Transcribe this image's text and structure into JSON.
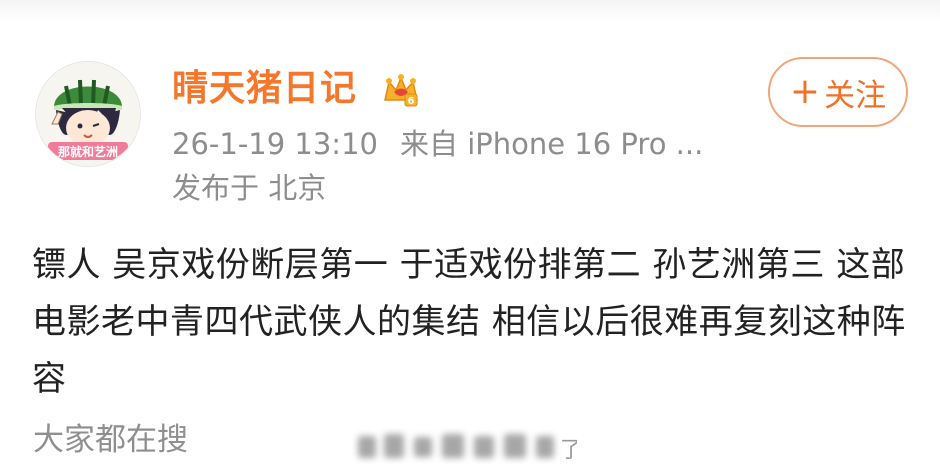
{
  "user": {
    "name": "晴天猪日记",
    "follow_label": "关注",
    "avatar_badge_text": "那就和艺洲"
  },
  "post": {
    "time": "26-1-19 13:10",
    "source": "来自 iPhone 16 Pro ...",
    "location": "发布于 北京",
    "body": "镖人 吴京戏份断层第一 于适戏份排第二 孙艺洲第三 这部电影老中青四代武侠人的集结 相信以后很难再复刻这种阵容"
  },
  "footer": {
    "search_label": "大家都在搜"
  },
  "colors": {
    "username": "#f5772b",
    "follow": "#f27128",
    "meta": "#8d8d8d",
    "body": "#222222"
  }
}
